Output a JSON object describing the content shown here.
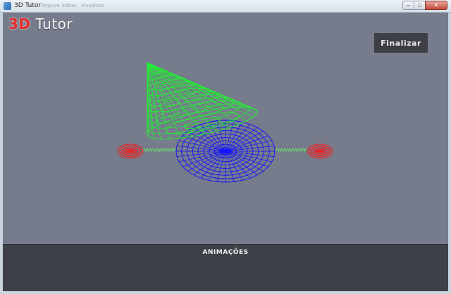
{
  "window": {
    "title": "3D Tutor",
    "ghost_menu": [
      "Arquivo",
      "Editar",
      "Visualizar"
    ],
    "controls": {
      "minimize": "–",
      "maximize": "□",
      "close": "✕"
    }
  },
  "logo": {
    "accent": "3D",
    "rest": " Tutor",
    "accent_color": "#e8272a"
  },
  "toolbar": {
    "finalizar_label": "Finalizar"
  },
  "panel": {
    "title": "ANIMAÇÕES"
  },
  "scene": {
    "background_color": "#767c8c",
    "objects": [
      {
        "name": "cone",
        "color": "#22ee33",
        "kind": "wireframe-cone"
      },
      {
        "name": "disk",
        "color": "#1010ff",
        "kind": "wireframe-disk"
      },
      {
        "name": "spring-left",
        "color": "#66dd66",
        "kind": "spring"
      },
      {
        "name": "spring-right",
        "color": "#66dd66",
        "kind": "spring"
      },
      {
        "name": "anchor-left",
        "color": "#ee2020",
        "kind": "wireframe-sphere"
      },
      {
        "name": "anchor-right",
        "color": "#ee2020",
        "kind": "wireframe-sphere"
      }
    ]
  }
}
